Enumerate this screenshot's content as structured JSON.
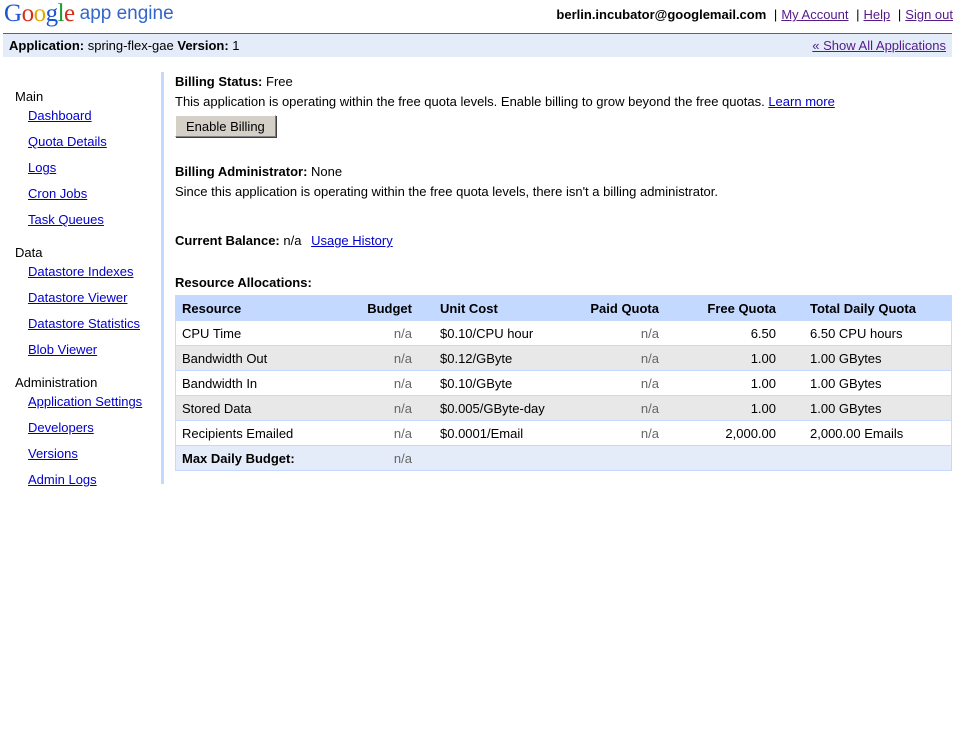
{
  "header": {
    "logo": {
      "G": "G",
      "o1": "o",
      "o2": "o",
      "g": "g",
      "l": "l",
      "e": "e",
      "product": "app engine"
    },
    "user_email": "berlin.incubator@googlemail.com",
    "links": {
      "my_account": "My Account",
      "help": "Help",
      "sign_out": "Sign out"
    },
    "separator": "|"
  },
  "appbar": {
    "application_label": "Application:",
    "application_value": "spring-flex-gae",
    "version_label": "Version:",
    "version_value": "1",
    "show_all": "« Show All Applications"
  },
  "sidebar": {
    "main_label": "Main",
    "main_items": [
      "Dashboard",
      "Quota Details",
      "Logs",
      "Cron Jobs",
      "Task Queues"
    ],
    "data_label": "Data",
    "data_items": [
      "Datastore Indexes",
      "Datastore Viewer",
      "Datastore Statistics",
      "Blob Viewer"
    ],
    "admin_label": "Administration",
    "admin_items": [
      "Application Settings",
      "Developers",
      "Versions",
      "Admin Logs"
    ]
  },
  "billing": {
    "status_label": "Billing Status:",
    "status_value": "Free",
    "status_text": "This application is operating within the free quota levels. Enable billing to grow beyond the free quotas.",
    "learn_more": "Learn more",
    "enable_button": "Enable Billing",
    "admin_label": "Billing Administrator:",
    "admin_value": "None",
    "admin_text": "Since this application is operating within the free quota levels, there isn't a billing administrator.",
    "balance_label": "Current Balance:",
    "balance_value": "n/a",
    "usage_history": "Usage History"
  },
  "allocations": {
    "title": "Resource Allocations:",
    "columns": [
      "Resource",
      "Budget",
      "Unit Cost",
      "Paid Quota",
      "Free Quota",
      "Total Daily Quota"
    ],
    "rows": [
      [
        "CPU Time",
        "n/a",
        "$0.10/CPU hour",
        "n/a",
        "6.50",
        "6.50 CPU hours"
      ],
      [
        "Bandwidth Out",
        "n/a",
        "$0.12/GByte",
        "n/a",
        "1.00",
        "1.00 GBytes"
      ],
      [
        "Bandwidth In",
        "n/a",
        "$0.10/GByte",
        "n/a",
        "1.00",
        "1.00 GBytes"
      ],
      [
        "Stored Data",
        "n/a",
        "$0.005/GByte-day",
        "n/a",
        "1.00",
        "1.00 GBytes"
      ],
      [
        "Recipients Emailed",
        "n/a",
        "$0.0001/Email",
        "n/a",
        "2,000.00",
        "2,000.00 Emails"
      ]
    ],
    "footer_label": "Max Daily Budget:",
    "footer_value": "n/a"
  },
  "colors": {
    "link": "#0000cc",
    "visited_link": "#551a8b",
    "appbar_bg": "#e5ecf9",
    "table_header_bg": "#c3d9ff",
    "row_stripe": "#e8e8e8"
  }
}
